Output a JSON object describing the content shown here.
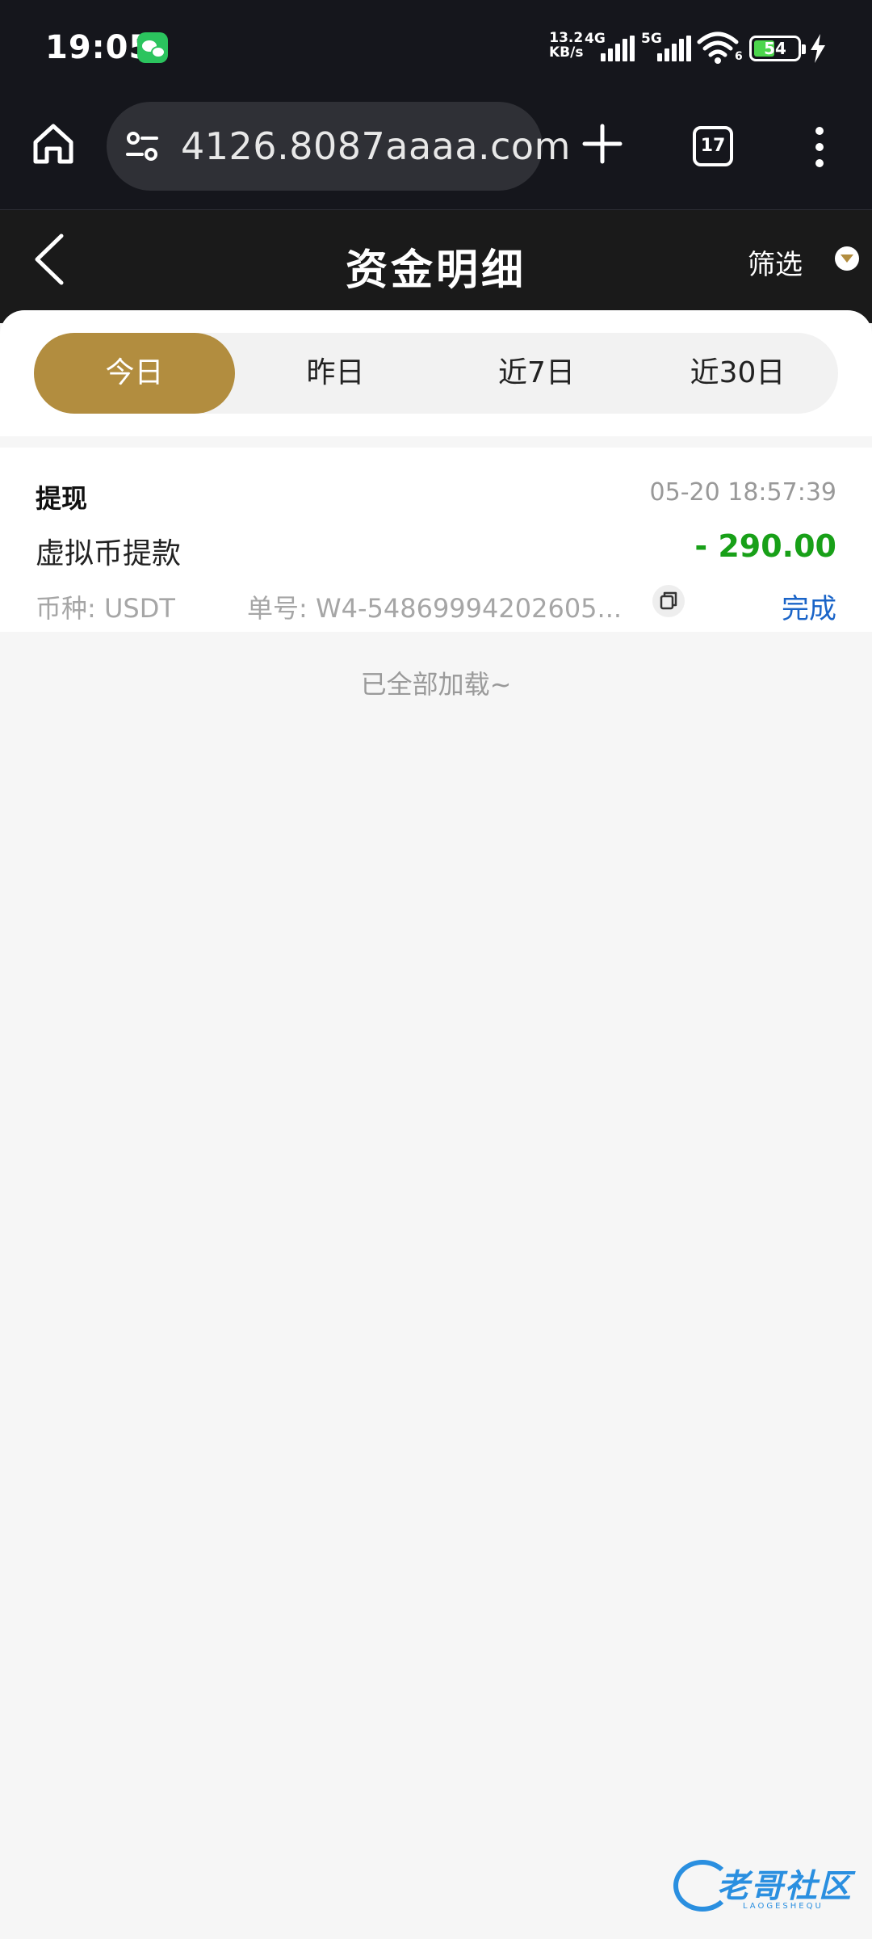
{
  "status_bar": {
    "time": "19:05",
    "net_speed_value": "13.2",
    "net_speed_unit": "KB/s",
    "network_1": "4G",
    "network_2": "5G",
    "wifi_sub": "6",
    "battery": "54",
    "battery_level_percent": 54
  },
  "browser": {
    "url": "4126.8087aaaa.com",
    "tab_count": "17"
  },
  "header": {
    "title": "资金明细",
    "filter_label": "筛选"
  },
  "tabs": [
    {
      "label": "今日",
      "active": true
    },
    {
      "label": "昨日",
      "active": false
    },
    {
      "label": "近7日",
      "active": false
    },
    {
      "label": "近30日",
      "active": false
    }
  ],
  "records": [
    {
      "type": "提现",
      "time": "05-20 18:57:39",
      "description": "虚拟币提款",
      "amount": "- 290.00",
      "currency": "币种: USDT",
      "order": "单号: W4-54869994202605...",
      "status": "完成"
    }
  ],
  "footer": {
    "loaded_text": "已全部加载~"
  },
  "watermark": {
    "text": "老哥社区",
    "sub": "LAOGESHEQU"
  },
  "colors": {
    "accent": "#b28d3f",
    "amount_negative": "#18a018",
    "status_done": "#1a64c8"
  }
}
